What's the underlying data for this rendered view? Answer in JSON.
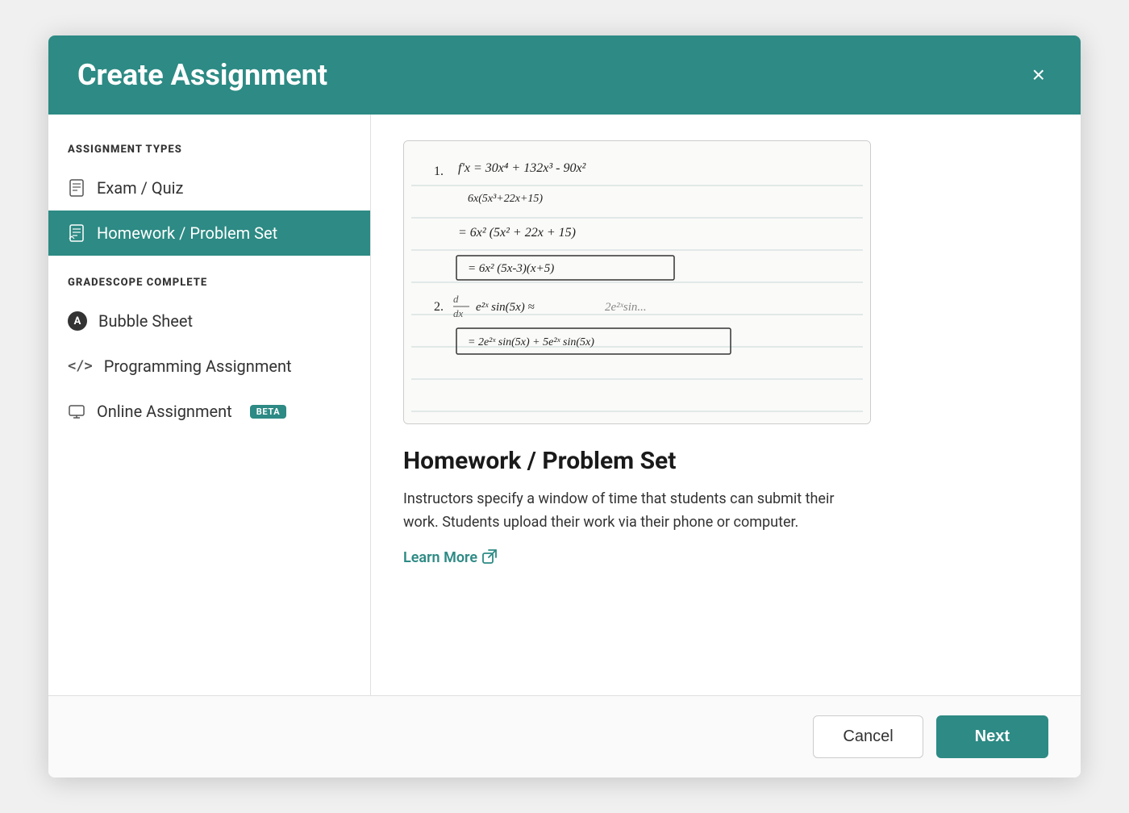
{
  "modal": {
    "title": "Create Assignment",
    "close_label": "×"
  },
  "sidebar": {
    "assignment_types_label": "ASSIGNMENT TYPES",
    "gradescope_complete_label": "GRADESCOPE COMPLETE",
    "items": [
      {
        "id": "exam-quiz",
        "label": "Exam / Quiz",
        "icon": "📄",
        "active": false,
        "beta": false
      },
      {
        "id": "homework-problem-set",
        "label": "Homework / Problem Set",
        "icon": "📋",
        "active": true,
        "beta": false
      },
      {
        "id": "bubble-sheet",
        "label": "Bubble Sheet",
        "icon": "A",
        "active": false,
        "beta": false
      },
      {
        "id": "programming-assignment",
        "label": "Programming Assignment",
        "icon": "</>",
        "active": false,
        "beta": false
      },
      {
        "id": "online-assignment",
        "label": "Online Assignment",
        "icon": "🖥",
        "active": false,
        "beta": true,
        "badge_label": "BETA"
      }
    ]
  },
  "content": {
    "title": "Homework / Problem Set",
    "description_line1": "Instructors specify a window of time that students can submit their",
    "description_line2": "work. Students upload their work via their phone or computer.",
    "learn_more_label": "Learn More",
    "learn_more_icon": "↗"
  },
  "footer": {
    "cancel_label": "Cancel",
    "next_label": "Next"
  }
}
